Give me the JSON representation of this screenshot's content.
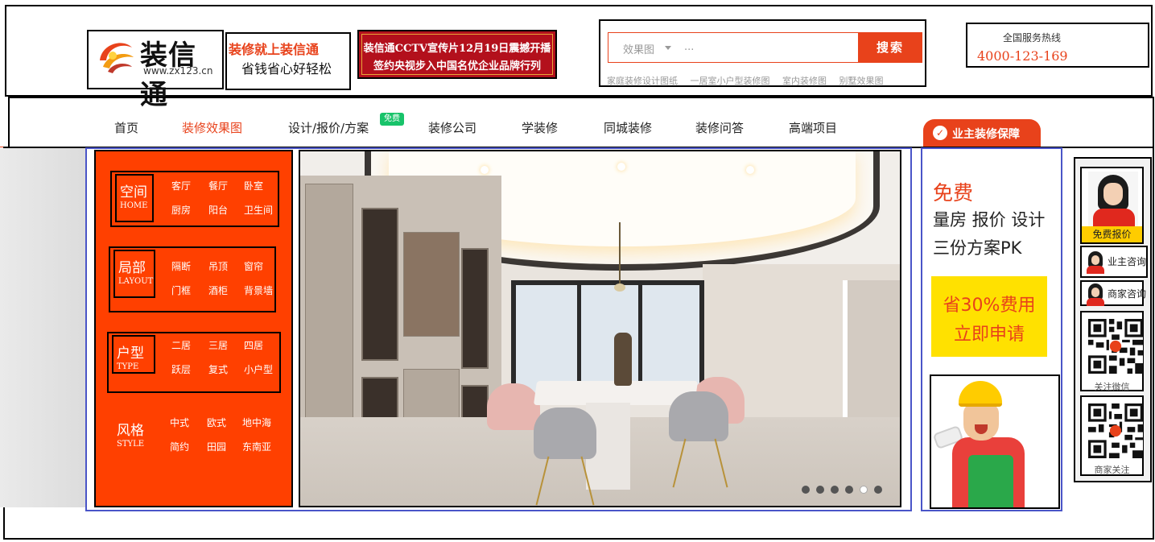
{
  "brand": {
    "logo_text": "装信通",
    "logo_url": "www.zx123.cn",
    "slogan_line1": "装修就上装信通",
    "slogan_line2": "省钱省心好轻松"
  },
  "ad_banner": {
    "line1": "装信通CCTV宣传片12月19日震撼开播",
    "line2": "签约央视步入中国名优企业品牌行列"
  },
  "search": {
    "category": "效果图",
    "placeholder": "...",
    "button_label": "搜索",
    "hot_links": [
      "家庭装修设计图纸",
      "一居室小户型装修图",
      "室内装修图",
      "别墅效果图"
    ]
  },
  "hotline": {
    "label": "全国服务热线",
    "number": "4000-123-169"
  },
  "nav": {
    "items": [
      {
        "label": "首页",
        "active": false
      },
      {
        "label": "装修效果图",
        "active": true
      },
      {
        "label": "设计/报价/方案",
        "active": false
      },
      {
        "label": "装修公司",
        "active": false
      },
      {
        "label": "学装修",
        "active": false
      },
      {
        "label": "同城装修",
        "active": false
      },
      {
        "label": "装修问答",
        "active": false
      },
      {
        "label": "高端项目",
        "active": false
      }
    ],
    "free_badge": "免费",
    "guarantee_label": "业主装修保障",
    "guarantee_icon": "shield-check-icon"
  },
  "categories": [
    {
      "title": "空间",
      "subtitle": "HOME",
      "links": [
        "客厅",
        "餐厅",
        "卧室",
        "厨房",
        "阳台",
        "卫生间"
      ]
    },
    {
      "title": "局部",
      "subtitle": "LAYOUT",
      "links": [
        "隔断",
        "吊顶",
        "窗帘",
        "门框",
        "酒柜",
        "背景墙"
      ]
    },
    {
      "title": "户型",
      "subtitle": "TYPE",
      "links": [
        "二居",
        "三居",
        "四居",
        "跃层",
        "复式",
        "小户型"
      ]
    },
    {
      "title": "风格",
      "subtitle": "STYLE",
      "links": [
        "中式",
        "欧式",
        "地中海",
        "简约",
        "田园",
        "东南亚"
      ]
    }
  ],
  "slider": {
    "dot_count": 6,
    "active_index": 4
  },
  "promo": {
    "free": "免费",
    "line1": "量房 报价 设计",
    "line2": "三份方案PK",
    "cta_line1": "省30%费用",
    "cta_line2": "立即申请"
  },
  "side_tools": {
    "free_quote": "免费报价",
    "owner_consult": "业主咨询",
    "merchant_consult": "商家咨询",
    "follow_wechat": "关注微信",
    "merchant_follow": "商家关注"
  },
  "colors": {
    "accent": "#e8421b",
    "category_panel": "#ff4000",
    "badge_green": "#18c36a",
    "promo_yellow": "#ffe100"
  }
}
